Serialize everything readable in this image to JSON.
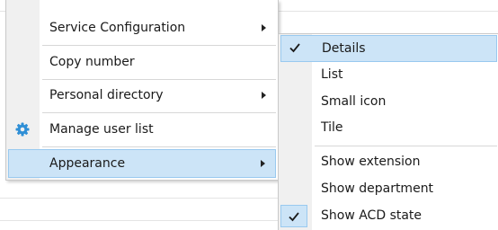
{
  "main_menu": {
    "items": [
      {
        "label": "Service Configuration",
        "has_submenu": true
      },
      {
        "label": "Copy number",
        "has_submenu": false
      },
      {
        "label": "Personal directory",
        "has_submenu": true
      },
      {
        "label": "Manage user list",
        "icon": "gear-icon",
        "has_submenu": false
      },
      {
        "label": "Appearance",
        "has_submenu": true,
        "selected": true
      }
    ]
  },
  "appearance_submenu": {
    "view_items": [
      {
        "label": "Details",
        "checked": true,
        "selected": true
      },
      {
        "label": "List",
        "checked": false
      },
      {
        "label": "Small icon",
        "checked": false
      },
      {
        "label": "Tile",
        "checked": false
      }
    ],
    "option_items": [
      {
        "label": "Show extension",
        "checked": false
      },
      {
        "label": "Show department",
        "checked": false
      },
      {
        "label": "Show ACD state",
        "checked": true
      }
    ]
  },
  "colors": {
    "selection_fill": "#cce4f7",
    "selection_border": "#99c9ef",
    "gear_icon": "#2f8fd6"
  }
}
